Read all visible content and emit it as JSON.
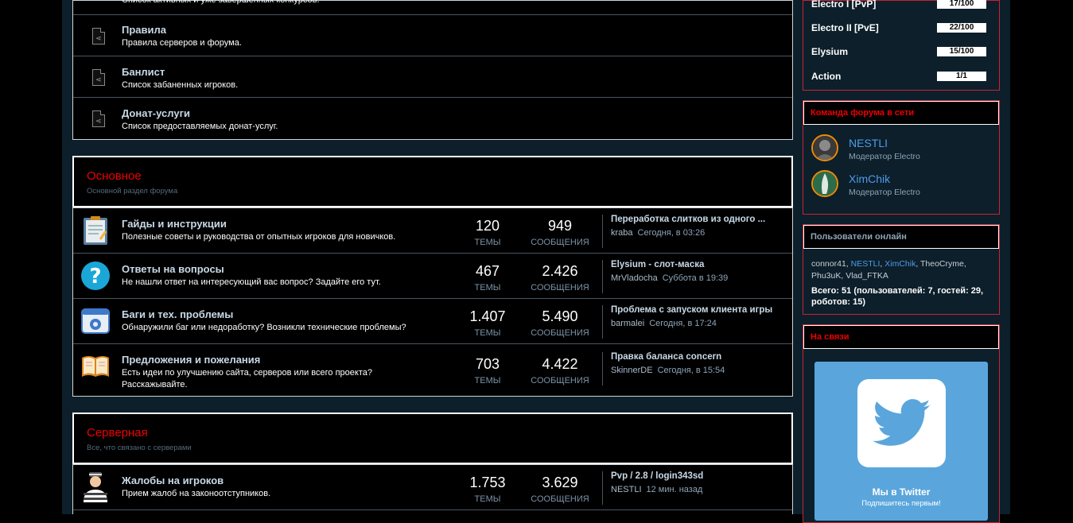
{
  "top_nodes": [
    {
      "title": "",
      "desc": "Список активных и уже завершенных конкурсов."
    },
    {
      "title": "Правила",
      "desc": "Правила серверов и форума."
    },
    {
      "title": "Банлист",
      "desc": "Список забаненных игроков."
    },
    {
      "title": "Донат-услуги",
      "desc": "Список предоставляемых донат-услуг."
    }
  ],
  "categories": [
    {
      "title": "Основное",
      "desc": "Основной раздел форума",
      "nodes": [
        {
          "title": "Гайды и инструкции",
          "desc": "Полезные советы и руководства от опытных игроков для новичков.",
          "icon": "notepad-icon",
          "threads": "120",
          "messages": "949",
          "last_title": "Переработка слитков из одного ...",
          "last_user": "kraba",
          "last_time": "Сегодня, в 03:26"
        },
        {
          "title": "Ответы на вопросы",
          "desc": "Не нашли ответ на интересующий вас вопрос? Задайте его тут.",
          "icon": "question-icon",
          "threads": "467",
          "messages": "2.426",
          "last_title": "Elysium - слот-маска",
          "last_user": "MrVladocha",
          "last_time": "Суббота в 19:39"
        },
        {
          "title": "Баги и тех. проблемы",
          "desc": "Обнаружили баг или недоработку? Возникли технические проблемы?",
          "icon": "settings-window-icon",
          "threads": "1.407",
          "messages": "5.490",
          "last_title": "Проблема с запуском клиента игры",
          "last_user": "barmalei",
          "last_time": "Сегодня, в 17:24"
        },
        {
          "title": "Предложения и пожелания",
          "desc": "Есть идеи по улучшению сайта, серверов или всего проекта? Расскажывайте.",
          "icon": "book-icon",
          "threads": "703",
          "messages": "4.422",
          "last_title": "Правка баланса concern",
          "last_user": "SkinnerDE",
          "last_time": "Сегодня, в 15:54"
        }
      ]
    },
    {
      "title": "Серверная",
      "desc": "Все, что связано с серверами",
      "nodes": [
        {
          "title": "Жалобы на игроков",
          "desc": "Прием жалоб на законоотступников.",
          "icon": "prisoner-icon",
          "threads": "1.753",
          "messages": "3.629",
          "last_title": "Pvp / 2.8 / login343sd",
          "last_user": "NESTLI",
          "last_time": "12 мин. назад"
        }
      ]
    }
  ],
  "labels": {
    "threads": "ТЕМЫ",
    "messages": "СООБЩЕНИЯ"
  },
  "servers": [
    {
      "name": "Electro I [PvP]",
      "status": "17/100"
    },
    {
      "name": "Electro II [PvE]",
      "status": "22/100"
    },
    {
      "name": "Elysium",
      "status": "15/100"
    },
    {
      "name": "Action",
      "status": "1/1"
    }
  ],
  "staff": {
    "title": "Команда форума в сети",
    "members": [
      {
        "name": "NESTLI",
        "role": "Модератор Electro"
      },
      {
        "name": "XimChik",
        "role": "Модератор Electro"
      }
    ]
  },
  "online": {
    "title": "Пользователи онлайн",
    "users": [
      "connor41",
      "NESTLI",
      "XimChik",
      "TheoCryme",
      "Phu3uK",
      "Vlad_FTKA"
    ],
    "total": "Всего: 51 (пользователей: 7, гостей: 29, роботов: 15)"
  },
  "social": {
    "title": "На связи",
    "card_title": "Мы в Twitter",
    "card_sub": "Подпишитесь первым!"
  },
  "colors": {
    "accent_red": "#e00000",
    "link_blue": "#4f9be8",
    "twitter": "#5aa6dc"
  }
}
